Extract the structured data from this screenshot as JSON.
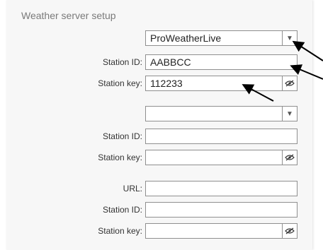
{
  "panel": {
    "title": "Weather server setup"
  },
  "group1": {
    "service_value": "ProWeatherLive",
    "station_id_label": "Station ID:",
    "station_id_value": "AABBCC",
    "station_key_label": "Station key:",
    "station_key_value": "112233"
  },
  "group2": {
    "service_value": "",
    "station_id_label": "Station ID:",
    "station_id_value": "",
    "station_key_label": "Station key:",
    "station_key_value": ""
  },
  "group3": {
    "url_label": "URL:",
    "url_value": "",
    "station_id_label": "Station ID:",
    "station_id_value": "",
    "station_key_label": "Station key:",
    "station_key_value": ""
  },
  "icons": {
    "dropdown": "chevron-down-icon",
    "visibility": "eye-slash-icon",
    "annotation": "arrow-icon"
  }
}
